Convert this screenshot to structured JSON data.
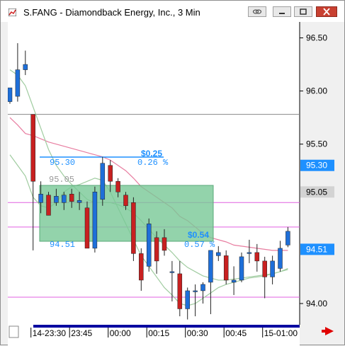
{
  "window": {
    "title": "S.FANG - Diamondback Energy, Inc., 3 Min",
    "buttons": [
      "link-icon",
      "minimize-icon",
      "maximize-icon",
      "close-icon"
    ],
    "title_color": "#000000",
    "close_color": "#c84031"
  },
  "chart_data": {
    "type": "candlestick",
    "symbol": "S.FANG",
    "interval": "3 Min",
    "y_ticks": [
      "96.50",
      "96.00",
      "95.50",
      "94.00"
    ],
    "y_tick_values": [
      96.5,
      96.0,
      95.5,
      94.0
    ],
    "ylim": [
      93.8,
      96.65
    ],
    "x_ticks": [
      "14-23:30",
      "23:45",
      "00:00",
      "00:15",
      "00:30",
      "00:45",
      "15-01:00"
    ],
    "x_tick_index": [
      3,
      8,
      13,
      18,
      23,
      28,
      33
    ],
    "price_badges": [
      {
        "label": "95.30",
        "value": 95.3,
        "color": "#1e90ff"
      },
      {
        "label": "95.05",
        "value": 95.05,
        "color": "#d3d3d3"
      },
      {
        "label": "94.51",
        "value": 94.51,
        "color": "#1e90ff"
      }
    ],
    "measure": {
      "high_label": "95.30",
      "low_label": "94.51",
      "mid_label": "95.05",
      "delta_top": "$0.25",
      "pct_top": "0.26 %",
      "delta_bottom": "$0.54",
      "pct_bottom": "0.57 %"
    },
    "hlines": [
      {
        "value": 95.78,
        "color": "#888888"
      },
      {
        "value": 94.95,
        "color": "#e060e0"
      },
      {
        "value": 94.72,
        "color": "#e060e0"
      },
      {
        "value": 94.06,
        "color": "#e060e0"
      }
    ],
    "candles": [
      {
        "o": 95.9,
        "h": 96.02,
        "l": 95.88,
        "c": 96.03
      },
      {
        "o": 95.95,
        "h": 96.45,
        "l": 95.9,
        "c": 96.2
      },
      {
        "o": 96.2,
        "h": 96.38,
        "l": 96.15,
        "c": 96.25
      },
      {
        "o": 95.78,
        "h": 95.78,
        "l": 94.5,
        "c": 95.15
      },
      {
        "o": 94.95,
        "h": 95.15,
        "l": 94.85,
        "c": 95.03
      },
      {
        "o": 95.02,
        "h": 95.05,
        "l": 94.83,
        "c": 94.83
      },
      {
        "o": 94.95,
        "h": 95.08,
        "l": 94.92,
        "c": 95.01
      },
      {
        "o": 94.95,
        "h": 95.05,
        "l": 94.88,
        "c": 95.02
      },
      {
        "o": 95.03,
        "h": 95.08,
        "l": 94.9,
        "c": 94.96
      },
      {
        "o": 94.95,
        "h": 95.05,
        "l": 94.88,
        "c": 94.97
      },
      {
        "o": 94.9,
        "h": 94.96,
        "l": 94.52,
        "c": 94.52
      },
      {
        "o": 94.52,
        "h": 95.1,
        "l": 94.48,
        "c": 95.05
      },
      {
        "o": 94.98,
        "h": 95.38,
        "l": 94.92,
        "c": 95.32
      },
      {
        "o": 95.3,
        "h": 95.35,
        "l": 95.05,
        "c": 95.15
      },
      {
        "o": 95.15,
        "h": 95.18,
        "l": 95.0,
        "c": 95.05
      },
      {
        "o": 95.02,
        "h": 95.05,
        "l": 94.88,
        "c": 94.92
      },
      {
        "o": 94.95,
        "h": 95.0,
        "l": 94.4,
        "c": 94.47
      },
      {
        "o": 94.47,
        "h": 94.52,
        "l": 94.12,
        "c": 94.22
      },
      {
        "o": 94.35,
        "h": 94.8,
        "l": 94.3,
        "c": 94.75
      },
      {
        "o": 94.62,
        "h": 94.68,
        "l": 94.28,
        "c": 94.4
      },
      {
        "o": 94.62,
        "h": 94.7,
        "l": 94.45,
        "c": 94.5
      },
      {
        "o": 94.3,
        "h": 94.4,
        "l": 94.02,
        "c": 94.3
      },
      {
        "o": 94.28,
        "h": 94.4,
        "l": 93.88,
        "c": 93.95
      },
      {
        "o": 93.95,
        "h": 94.15,
        "l": 93.85,
        "c": 94.12
      },
      {
        "o": 94.12,
        "h": 94.18,
        "l": 93.88,
        "c": 94.12
      },
      {
        "o": 94.12,
        "h": 94.2,
        "l": 94.0,
        "c": 94.18
      },
      {
        "o": 94.2,
        "h": 94.5,
        "l": 93.9,
        "c": 94.5
      },
      {
        "o": 94.45,
        "h": 94.54,
        "l": 94.4,
        "c": 94.48
      },
      {
        "o": 94.45,
        "h": 94.5,
        "l": 94.18,
        "c": 94.22
      },
      {
        "o": 94.2,
        "h": 94.35,
        "l": 94.08,
        "c": 94.22
      },
      {
        "o": 94.22,
        "h": 94.48,
        "l": 94.2,
        "c": 94.44
      },
      {
        "o": 94.48,
        "h": 94.6,
        "l": 94.38,
        "c": 94.48
      },
      {
        "o": 94.48,
        "h": 94.56,
        "l": 94.3,
        "c": 94.4
      },
      {
        "o": 94.4,
        "h": 94.44,
        "l": 94.05,
        "c": 94.25
      },
      {
        "o": 94.25,
        "h": 94.45,
        "l": 94.18,
        "c": 94.4
      },
      {
        "o": 94.33,
        "h": 94.59,
        "l": 94.3,
        "c": 94.52
      },
      {
        "o": 94.55,
        "h": 94.72,
        "l": 94.53,
        "c": 94.68
      }
    ],
    "bull_color": "#1e6fd9",
    "bear_color": "#c82020",
    "bands": {
      "upper": [
        95.75,
        95.68,
        95.6,
        95.58,
        95.55,
        95.52,
        95.5,
        95.48,
        95.46,
        95.44,
        95.42,
        95.4,
        95.38,
        95.35,
        95.3,
        95.25,
        95.18,
        95.1,
        95.05,
        95.0,
        94.95,
        94.9,
        94.82,
        94.78,
        94.72,
        94.66,
        94.62,
        94.6,
        94.58,
        94.55,
        94.54,
        94.53,
        94.52,
        94.51,
        94.5,
        94.5,
        94.5
      ],
      "middle": [
        96.2,
        96.15,
        96.05,
        95.85,
        95.65,
        95.45,
        95.3,
        95.2,
        95.12,
        95.05,
        94.98,
        94.95,
        94.95,
        94.95,
        94.93,
        94.9,
        94.85,
        94.78,
        94.7,
        94.62,
        94.55,
        94.48,
        94.4,
        94.34,
        94.3,
        94.26,
        94.24,
        94.22,
        94.22,
        94.23,
        94.24,
        94.25,
        94.26,
        94.27,
        94.28,
        94.3,
        94.32
      ],
      "lower": [
        95.4,
        95.3,
        95.2,
        95.0,
        94.92,
        94.9,
        94.95,
        95.05,
        95.1,
        95.12,
        95.15,
        95.18,
        95.16,
        95.05,
        94.9,
        94.75,
        94.6,
        94.45,
        94.35,
        94.25,
        94.15,
        94.08,
        94.0,
        93.98,
        94.0,
        94.05,
        94.1,
        94.15,
        94.18,
        94.2,
        94.22,
        94.24,
        94.25,
        94.26,
        94.28,
        94.3,
        94.33
      ]
    }
  }
}
